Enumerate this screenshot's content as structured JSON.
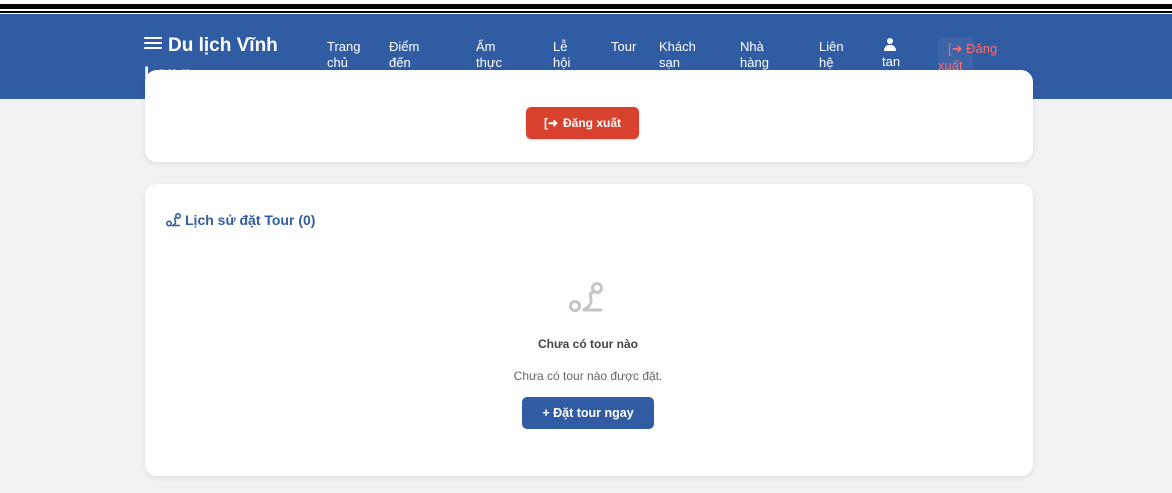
{
  "brand": {
    "name": "Du lịch Vĩnh Long",
    "icon": "menu-lines-icon"
  },
  "nav": {
    "items": [
      {
        "label": "Trang chủ"
      },
      {
        "label": "Điểm đến"
      },
      {
        "label": "Ẩm thực"
      },
      {
        "label": "Lễ hội"
      },
      {
        "label": "Tour"
      },
      {
        "label": "Khách sạn"
      },
      {
        "label": "Nhà hàng"
      },
      {
        "label": "Liên hệ"
      }
    ],
    "user": {
      "name": "tan",
      "icon": "user-icon"
    },
    "logout": {
      "label1": "Đăng",
      "label2": "xuất",
      "icon": "sign-out-icon"
    }
  },
  "account": {
    "logout_button": "Đăng xuất"
  },
  "history": {
    "title": "Lịch sử đặt Tour (0)",
    "empty_title": "Chưa có tour nào",
    "empty_desc": "Chưa có tour nào được đặt.",
    "book_button": "+ Đặt tour ngay",
    "icon": "route-icon"
  },
  "colors": {
    "primary": "#2f5ca3",
    "danger": "#d9412f",
    "danger_text": "#ff6b6b",
    "background": "#f2f2f4"
  }
}
